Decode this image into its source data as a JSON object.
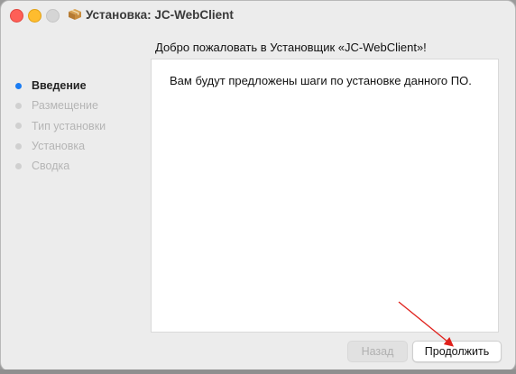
{
  "window": {
    "title": "Установка: JC-WebClient"
  },
  "sidebar": {
    "steps": [
      {
        "label": "Введение",
        "active": true
      },
      {
        "label": "Размещение",
        "active": false
      },
      {
        "label": "Тип установки",
        "active": false
      },
      {
        "label": "Установка",
        "active": false
      },
      {
        "label": "Сводка",
        "active": false
      }
    ]
  },
  "main": {
    "heading": "Добро пожаловать в Установщик «JC-WebClient»!",
    "body_text": "Вам будут предложены шаги по установке данного ПО."
  },
  "buttons": {
    "back_label": "Назад",
    "continue_label": "Продолжить"
  },
  "colors": {
    "accent": "#1a7cf3",
    "annotation_arrow": "#e0201b"
  },
  "icons": {
    "app": "package-icon"
  }
}
